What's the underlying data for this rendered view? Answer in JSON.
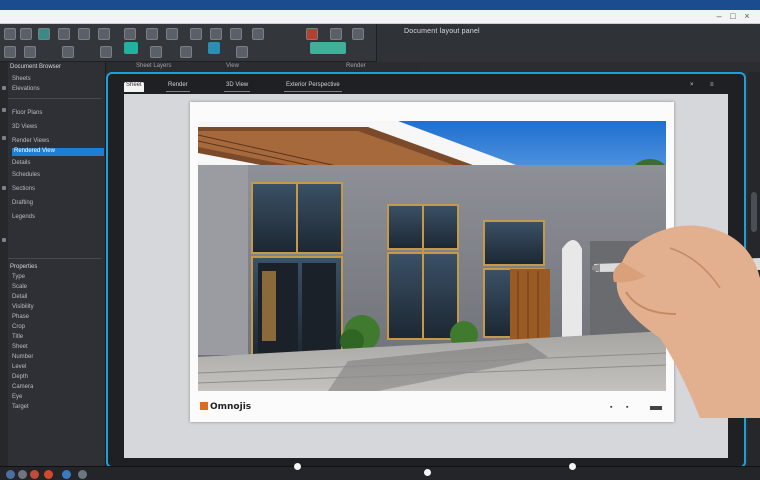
{
  "app": {
    "title_bar_label": "",
    "toolbar_right_label": "Document layout panel"
  },
  "subbar": {
    "labels": [
      "Sheet Layers",
      "View",
      "Render"
    ]
  },
  "left_panel": {
    "header": "Document Browser",
    "rows": [
      "Sheets",
      "Elevations",
      "Floor Plans",
      "3D Views",
      "Render Views",
      "Details",
      "Schedules",
      "Sections",
      "Drafting",
      "Legends"
    ],
    "selected_row": "Rendered View",
    "section2_header": "Properties",
    "section2_rows": [
      "Type",
      "Scale",
      "Detail",
      "Visibility",
      "Phase",
      "Crop",
      "Title",
      "Sheet",
      "Number",
      "Level",
      "Depth",
      "Camera",
      "Eye",
      "Target"
    ]
  },
  "document": {
    "tabs": [
      "Sheet",
      "Render",
      "3D View",
      "Exterior Perspective"
    ],
    "active_tab": 3,
    "logo_text": "Omnojis",
    "colors": {
      "accent": "#1da0d8",
      "selection": "#1d7ed6",
      "logo_mark": "#e26a1c"
    }
  },
  "icons": [
    "menu-icon",
    "save-icon",
    "undo-icon",
    "redo-icon",
    "print-icon",
    "zoom-icon",
    "pen-icon",
    "layers-icon"
  ]
}
